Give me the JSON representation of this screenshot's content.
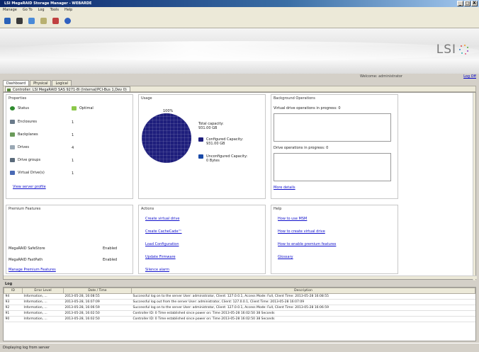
{
  "window": {
    "title": "LSI MegaRAID Storage Manager - WEBARDE",
    "buttons": [
      "_",
      "□",
      "X"
    ]
  },
  "menu": [
    "Manage",
    "Go To",
    "Log",
    "Tools",
    "Help"
  ],
  "toolbar_icons": [
    "refresh-icon",
    "properties-icon",
    "enclosure-icon",
    "device-icon",
    "alert-icon",
    "help-icon"
  ],
  "banner": {
    "logo": "LSI"
  },
  "user": {
    "name": "Welcome: administrator",
    "logoff": "Log Off"
  },
  "tabs": [
    "Dashboard",
    "Physical",
    "Logical"
  ],
  "controller_tab": "Controller: LSI MegaRAID SAS 9271-8i (Internal/PCI-Bus 1,Dev 0)",
  "properties": {
    "title": "Properties",
    "rows": [
      {
        "icon": "status-icon",
        "label": "Status",
        "value": "Optimal",
        "color": "#2e8b2e"
      },
      {
        "icon": "enclosure-icon",
        "label": "Enclosures",
        "value": "1"
      },
      {
        "icon": "backplane-icon",
        "label": "Backplanes",
        "value": "1"
      },
      {
        "icon": "drives-icon",
        "label": "Drives",
        "value": "4"
      },
      {
        "icon": "drive-groups-icon",
        "label": "Drive groups",
        "value": "1"
      },
      {
        "icon": "virtual-drives-icon",
        "label": "Virtual Drive(s)",
        "value": "1"
      }
    ],
    "link": "View server profile"
  },
  "usage": {
    "title": "Usage",
    "pie_label": "100%",
    "total": "Total capacity:\n931.00 GB",
    "legend": [
      {
        "label": "Configured Capacity:\n931.00 GB",
        "color": "#1e1e7c"
      },
      {
        "label": "Unconfigured Capacity:\n0 Bytes",
        "color": "#1a4aa8"
      }
    ]
  },
  "background": {
    "title": "Background Operations",
    "vd_label": "Virtual drive operations in progress: 0",
    "drive_label": "Drive operations in progress: 0",
    "link": "More details"
  },
  "premium": {
    "title": "Premium Features",
    "rows": [
      {
        "label": "MegaRAID SafeStore",
        "value": "Enabled"
      },
      {
        "label": "MegaRAID FastPath",
        "value": "Enabled"
      }
    ],
    "link": "Manage Premium Features"
  },
  "actions": {
    "title": "Actions",
    "links": [
      "Create virtual drive",
      "Create CacheCade™",
      "Load Configuration",
      "Update Firmware",
      "Silence alarm"
    ]
  },
  "help": {
    "title": "Help",
    "links": [
      "How to use MSM",
      "How to create virtual drive",
      "How to enable premium features",
      "Glossary"
    ]
  },
  "log": {
    "title": "Log",
    "headers": [
      "ID",
      "Error Level",
      "Date / Time",
      "Description"
    ],
    "rows": [
      [
        "94",
        "Information, ...",
        "2013-05-28, 16:08:55",
        "Successful log on to the server User:  administrator, Client:  127.0.0.1,   Access Mode:  Full, Client Time:  2013-05-28 16:08:55"
      ],
      [
        "93",
        "Information, ...",
        "2013-05-28, 16:07:09",
        "Successful log out from the server User:  administrator, Client:  127.0.0.1,   Client Time:  2013-05-28 16:07:09"
      ],
      [
        "92",
        "Information, ...",
        "2013-05-28, 16:06:59",
        "Successful log on to the server User:  administrator, Client:  127.0.0.1,   Access Mode:  Full, Client Time:  2013-05-28 16:06:59"
      ],
      [
        "91",
        "Information, ...",
        "2013-05-28, 16:02:50",
        "Controller ID:  0   Time established since power on:  Time  2013-05-28 16:02:50   38 Seconds"
      ],
      [
        "90",
        "Information, ...",
        "2013-05-28, 16:02:50",
        "Controller ID:  0   Time established since power on:  Time  2013-05-28 16:02:50   38 Seconds"
      ]
    ]
  },
  "status": "Displaying log from server"
}
